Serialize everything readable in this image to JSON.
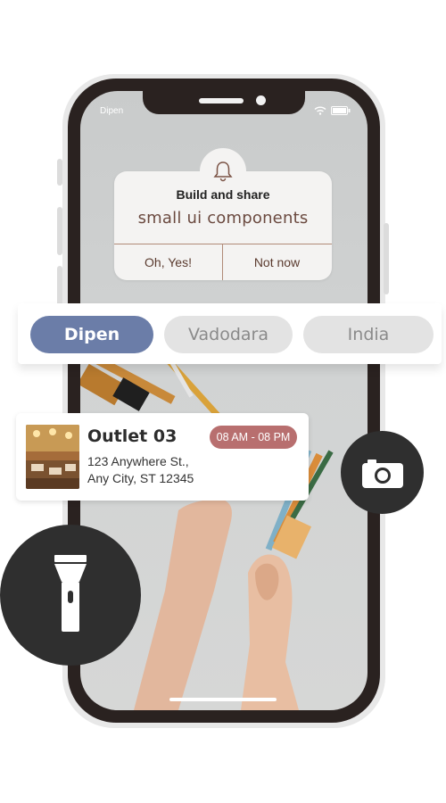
{
  "status_bar": {
    "carrier": "Dipen"
  },
  "notification": {
    "icon": "bell-icon",
    "title": "Build and share",
    "subtitle": "small ui components",
    "confirm_label": "Oh, Yes!",
    "dismiss_label": "Not now"
  },
  "tabs": [
    {
      "label": "Dipen",
      "active": true
    },
    {
      "label": "Vadodara",
      "active": false
    },
    {
      "label": "India",
      "active": false
    }
  ],
  "outlet": {
    "name": "Outlet 03",
    "hours": "08 AM - 08 PM",
    "address_line1": "123 Anywhere St.,",
    "address_line2": "Any City, ST 12345"
  },
  "actions": {
    "camera_icon": "camera-icon",
    "flashlight_icon": "flashlight-icon"
  },
  "colors": {
    "tab_active": "#6b7da8",
    "tab_inactive": "#e3e3e3",
    "hours_badge": "#b86f6f",
    "notification_text": "#6b4a40",
    "fab": "#2f2f2f"
  }
}
